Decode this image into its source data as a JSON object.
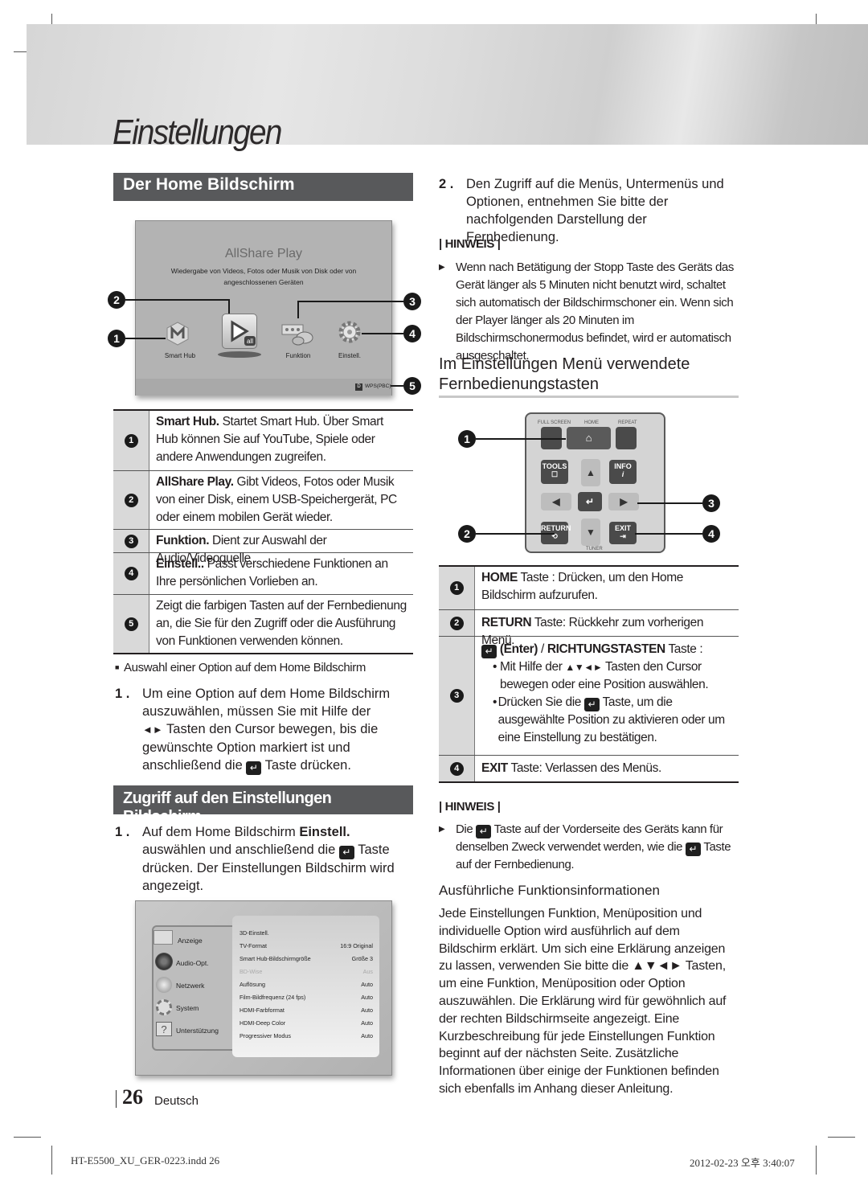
{
  "page": {
    "chapter_title": "Einstellungen",
    "page_number": "26",
    "language": "Deutsch",
    "footer_file": "HT-E5500_XU_GER-0223.indd   26",
    "footer_timestamp": "2012-02-23   오후 3:40:07"
  },
  "home_section": {
    "title": "Der Home Bildschirm",
    "screen": {
      "heading": "AllShare Play",
      "description_line1": "Wiedergabe von Videos, Fotos oder Musik von Disk oder von",
      "description_line2": "angeschlossenen Geräten",
      "icons": [
        {
          "label": "Smart Hub",
          "icon": "smart-hub-icon"
        },
        {
          "label": "",
          "icon": "allshare-play-icon"
        },
        {
          "label": "Funktion",
          "icon": "function-icon"
        },
        {
          "label": "Einstell.",
          "icon": "settings-gear-icon"
        }
      ],
      "status_key": "D",
      "status_label": "WPS(PBC)"
    },
    "callouts": [
      "1",
      "2",
      "3",
      "4",
      "5"
    ],
    "table": [
      {
        "num": "1",
        "bold": "Smart Hub.",
        "text": " Startet Smart Hub. Über Smart Hub können Sie auf YouTube, Spiele oder andere Anwendungen zugreifen."
      },
      {
        "num": "2",
        "bold": "AllShare Play.",
        "text": " Gibt Videos, Fotos oder Musik von einer Disk, einem USB-Speichergerät, PC oder einem mobilen Gerät wieder."
      },
      {
        "num": "3",
        "bold": "Funktion.",
        "text": " Dient zur Auswahl der Audio/Videoquelle"
      },
      {
        "num": "4",
        "bold": "Einstell..",
        "text": " Passt verschiedene Funktionen an Ihre persönlichen Vorlieben an."
      },
      {
        "num": "5",
        "bold": "",
        "text": "Zeigt die farbigen Tasten auf der Fernbedienung an, die Sie für den Zugriff oder die Ausführung von Funktionen verwenden können."
      }
    ],
    "subheading": "Auswahl einer Option auf dem Home Bildschirm",
    "step1_num": "1 .",
    "step1_a": "Um eine Option auf dem Home Bildschirm auszuwählen, müssen Sie mit Hilfe der",
    "step1_arrows": "◄►",
    "step1_b": " Tasten den Cursor bewegen, bis die gewünschte Option markiert ist und anschließend die ",
    "step1_c": " Taste drücken."
  },
  "access_section": {
    "title": "Zugriff auf den Einstellungen Bildschirm",
    "step1_num": "1 .",
    "step1_a": "Auf dem Home Bildschirm ",
    "step1_bold": "Einstell.",
    "step1_b": " auswählen und anschließend die ",
    "step1_c": " Taste drücken. Der Einstellungen Bildschirm wird angezeigt.",
    "settings_screen": {
      "menu": [
        {
          "label": "Anzeige",
          "icon": "display-icon"
        },
        {
          "label": "Audio-Opt.",
          "icon": "speaker-icon"
        },
        {
          "label": "Netzwerk",
          "icon": "globe-icon"
        },
        {
          "label": "System",
          "icon": "gear-icon"
        },
        {
          "label": "Unterstützung",
          "icon": "help-icon"
        }
      ],
      "options": [
        {
          "label": "3D-Einstell.",
          "value": ""
        },
        {
          "label": "TV-Format",
          "value": "16:9 Original"
        },
        {
          "label": "Smart Hub-Bildschirmgröße",
          "value": "Größe 3"
        },
        {
          "label": "BD-Wise",
          "value": "Aus",
          "disabled": true
        },
        {
          "label": "Auflösung",
          "value": "Auto"
        },
        {
          "label": "Film-Bildfrequenz (24 fps)",
          "value": "Auto"
        },
        {
          "label": "HDMI-Farbformat",
          "value": "Auto"
        },
        {
          "label": "HDMI-Deep Color",
          "value": "Auto"
        },
        {
          "label": "Progressiver Modus",
          "value": "Auto"
        }
      ]
    }
  },
  "right": {
    "step2_num": "2 .",
    "step2_text": "Den Zugriff auf die Menüs, Untermenüs und Optionen, entnehmen Sie bitte der nachfolgenden Darstellung der Fernbedienung.",
    "hinweis1_label": "| HINWEIS |",
    "hinweis1_text": "Wenn nach Betätigung der Stopp Taste des Geräts das Gerät länger als 5 Minuten nicht benutzt wird, schaltet sich automatisch der Bildschirmschoner ein. Wenn sich der Player länger als 20 Minuten im Bildschirmschonermodus befindet, wird er automatisch ausgeschaltet.",
    "remote_heading": "Im Einstellungen Menü verwendete Fernbedienungstasten",
    "remote": {
      "labels": {
        "full_screen": "FULL SCREEN",
        "home": "HOME",
        "repeat": "REPEAT",
        "tools": "TOOLS",
        "info": "INFO",
        "return": "RETURN",
        "exit": "EXIT",
        "tuner": "TUNER"
      },
      "callouts": [
        "1",
        "2",
        "3",
        "4"
      ]
    },
    "remote_table": {
      "row1_num": "1",
      "row1_bold": "HOME",
      "row1_text": " Taste : Drücken, um den Home Bildschirm aufzurufen.",
      "row2_num": "2",
      "row2_bold": "RETURN",
      "row2_text": " Taste: Rückkehr zum vorherigen Menü.",
      "row3_num": "3",
      "row3_enter": "(Enter)",
      "row3_sep": " / ",
      "row3_bold": "RICHTUNGSTASTEN",
      "row3_text": " Taste :",
      "row3_b1_a": "Mit Hilfe der ",
      "row3_b1_arrows": "▲▼◄►",
      "row3_b1_b": " Tasten den Cursor bewegen oder eine Position auswählen.",
      "row3_b2_a": "Drücken Sie die ",
      "row3_b2_b": " Taste, um die ausgewählte Position zu aktivieren oder um eine Einstellung zu bestätigen.",
      "row4_num": "4",
      "row4_bold": "EXIT",
      "row4_text": " Taste: Verlassen des Menüs."
    },
    "hinweis2_label": "| HINWEIS |",
    "hinweis2_a": "Die ",
    "hinweis2_b": " Taste auf der Vorderseite des Geräts kann für denselben Zweck verwendet werden, wie die ",
    "hinweis2_c": " Taste auf der Fernbedienung.",
    "info_heading": "Ausführliche Funktionsinformationen",
    "info_text": "Jede Einstellungen Funktion, Menüposition und individuelle Option wird ausführlich auf dem Bildschirm erklärt. Um sich eine Erklärung anzeigen zu lassen, verwenden Sie bitte die ▲▼◄► Tasten, um eine Funktion, Menüposition oder Option auszuwählen. Die Erklärung wird für gewöhnlich auf der rechten Bildschirmseite angezeigt. Eine Kurzbeschreibung für jede Einstellungen Funktion beginnt auf der nächsten Seite. Zusätzliche Informationen über einige der Funktionen befinden sich ebenfalls im Anhang dieser Anleitung."
  }
}
